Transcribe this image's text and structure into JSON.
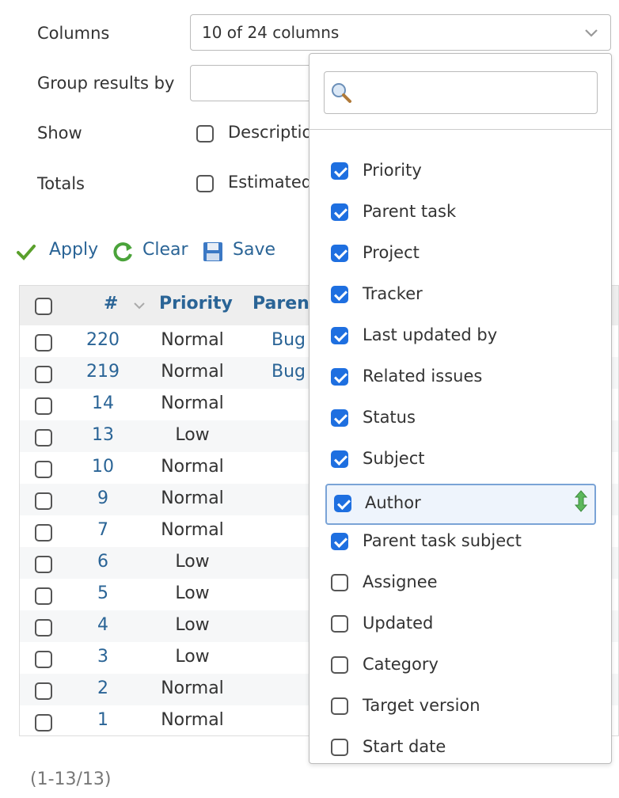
{
  "form": {
    "columns_label": "Columns",
    "columns_value": "10 of 24 columns",
    "group_label": "Group results by",
    "show_label": "Show",
    "show_option": "Descriptio",
    "totals_label": "Totals",
    "totals_option": "Estimated"
  },
  "actions": {
    "apply": "Apply",
    "clear": "Clear",
    "save": "Save"
  },
  "table": {
    "headers": {
      "num": "#",
      "priority": "Priority",
      "parent": "Paren"
    },
    "rows": [
      {
        "num": "220",
        "priority": "Normal",
        "parent": "Bug"
      },
      {
        "num": "219",
        "priority": "Normal",
        "parent": "Bug"
      },
      {
        "num": "14",
        "priority": "Normal",
        "parent": ""
      },
      {
        "num": "13",
        "priority": "Low",
        "parent": ""
      },
      {
        "num": "10",
        "priority": "Normal",
        "parent": ""
      },
      {
        "num": "9",
        "priority": "Normal",
        "parent": ""
      },
      {
        "num": "7",
        "priority": "Normal",
        "parent": ""
      },
      {
        "num": "6",
        "priority": "Low",
        "parent": ""
      },
      {
        "num": "5",
        "priority": "Low",
        "parent": ""
      },
      {
        "num": "4",
        "priority": "Low",
        "parent": ""
      },
      {
        "num": "3",
        "priority": "Low",
        "parent": ""
      },
      {
        "num": "2",
        "priority": "Normal",
        "parent": ""
      },
      {
        "num": "1",
        "priority": "Normal",
        "parent": ""
      }
    ]
  },
  "pagination": "(1-13/13)",
  "dropdown": {
    "search_placeholder": "",
    "options": [
      {
        "label": "Priority",
        "checked": true
      },
      {
        "label": "Parent task",
        "checked": true
      },
      {
        "label": "Project",
        "checked": true
      },
      {
        "label": "Tracker",
        "checked": true
      },
      {
        "label": "Last updated by",
        "checked": true
      },
      {
        "label": "Related issues",
        "checked": true
      },
      {
        "label": "Status",
        "checked": true
      },
      {
        "label": "Subject",
        "checked": true
      },
      {
        "label": "Author",
        "checked": true,
        "highlighted": true
      },
      {
        "label": "Parent task subject",
        "checked": true
      },
      {
        "label": "Assignee",
        "checked": false
      },
      {
        "label": "Updated",
        "checked": false
      },
      {
        "label": "Category",
        "checked": false
      },
      {
        "label": "Target version",
        "checked": false
      },
      {
        "label": "Start date",
        "checked": false
      }
    ]
  },
  "colors": {
    "link": "#2a6496",
    "checkbox_on": "#1e6fe0",
    "highlight_border": "#7aa3d6"
  }
}
